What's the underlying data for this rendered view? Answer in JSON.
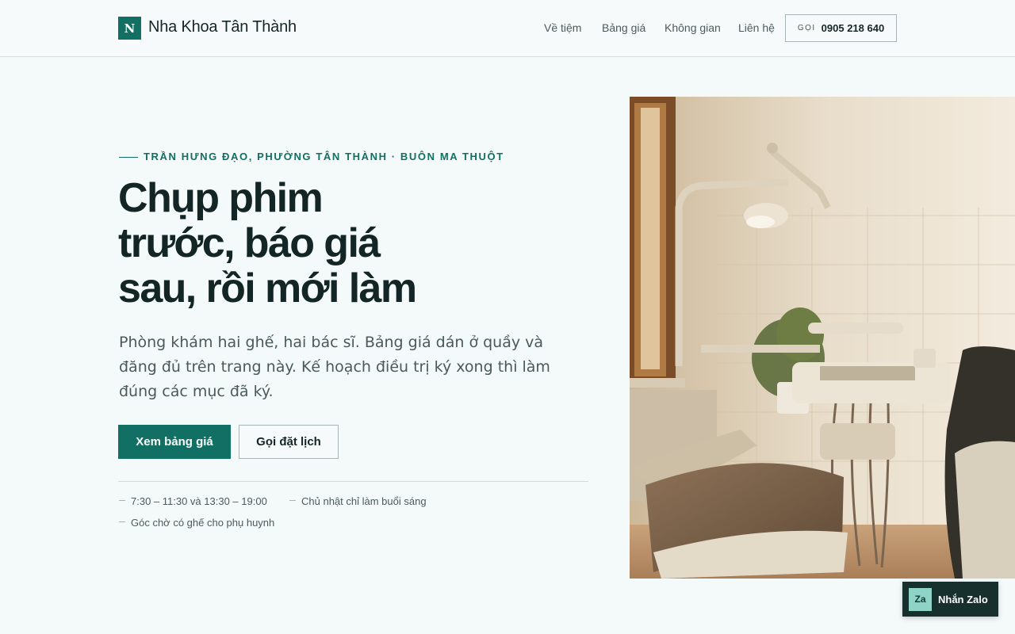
{
  "header": {
    "logo_letter": "N",
    "brand": "Nha Khoa Tân Thành",
    "nav": [
      "Về tiệm",
      "Bảng giá",
      "Không gian",
      "Liên hệ"
    ],
    "call_prefix": "GỌI",
    "call_number": "0905 218 640"
  },
  "hero": {
    "eyebrow": "TRẦN HƯNG ĐẠO, PHƯỜNG TÂN THÀNH · BUÔN MA THUỘT",
    "headline_lines": [
      "Chụp phim",
      "trước, báo giá",
      "sau, rồi mới làm"
    ],
    "lead": "Phòng khám hai ghế, hai bác sĩ. Bảng giá dán ở quầy và đăng đủ trên trang này. Kế hoạch điều trị ký xong thì làm đúng các mục đã ký.",
    "primary_button": "Xem bảng giá",
    "secondary_button": "Gọi đặt lịch",
    "facts": [
      "7:30 – 11:30 và 13:30 – 19:00",
      "Chủ nhật chỉ làm buổi sáng",
      "Góc chờ có ghế cho phụ huynh"
    ]
  },
  "image": {
    "subject": "dental-clinic-room-photo"
  },
  "zalo": {
    "badge": "Za",
    "label": "Nhắn Zalo"
  },
  "colors": {
    "accent": "#116f63",
    "background": "#f4f9f9",
    "text": "#132525",
    "zalo_bg": "#17302d"
  }
}
